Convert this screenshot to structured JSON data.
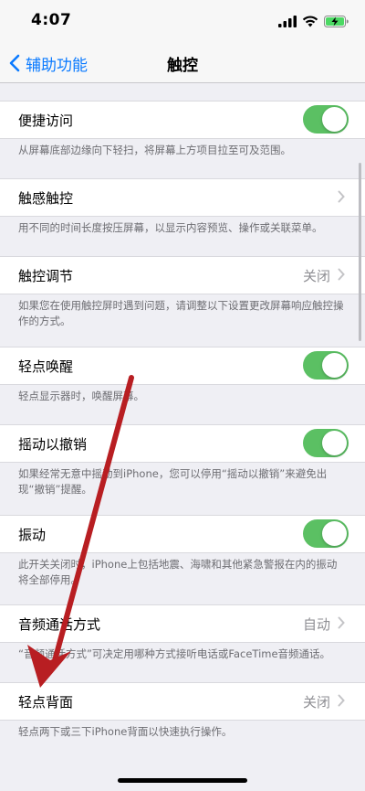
{
  "status": {
    "time": "4:07"
  },
  "nav": {
    "back_label": "辅助功能",
    "title": "触控"
  },
  "rows": [
    {
      "label": "便捷访问",
      "desc": "从屏幕底部边缘向下轻扫，将屏幕上方项目拉至可及范围。"
    },
    {
      "label": "触感触控",
      "desc": "用不同的时间长度按压屏幕，以显示内容预览、操作或关联菜单。"
    },
    {
      "label": "触控调节",
      "value": "关闭",
      "desc": "如果您在使用触控屏时遇到问题，请调整以下设置更改屏幕响应触控操作的方式。"
    },
    {
      "label": "轻点唤醒",
      "desc": "轻点显示器时，唤醒屏幕。"
    },
    {
      "label": "摇动以撤销",
      "desc": "如果经常无意中摇动到iPhone，您可以停用“摇动以撤销”来避免出现“撤销”提醒。"
    },
    {
      "label": "振动",
      "desc": "此开关关闭时，iPhone上包括地震、海啸和其他紧急警报在内的振动将全部停用。"
    },
    {
      "label": "音频通话方式",
      "value": "自动",
      "desc": "“音频通话方式”可决定用哪种方式接听电话或FaceTime音频通话。"
    },
    {
      "label": "轻点背面",
      "value": "关闭",
      "desc": "轻点两下或三下iPhone背面以快速执行操作。"
    }
  ],
  "colors": {
    "accent": "#0a7aff",
    "toggle_on": "#5bc063",
    "annotation_arrow": "#b81e22"
  }
}
